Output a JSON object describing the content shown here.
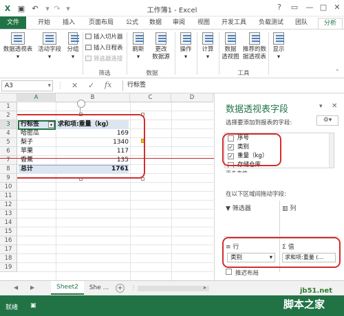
{
  "window": {
    "title": "工作簿1 - Excel",
    "help_label": "?",
    "minimize_label": "—",
    "restore_label": "□",
    "close_label": "✕"
  },
  "tabs": [
    "文件",
    "开始",
    "插入",
    "页面布局",
    "公式",
    "数据",
    "审阅",
    "视图",
    "开发工具",
    "负载测试",
    "团队",
    "分析"
  ],
  "ribbon": {
    "pivot_table": "数据透视表",
    "active_field": "活动字段",
    "group": "分组",
    "insert_slicer": "插入切片器",
    "insert_timeline": "插入日程表",
    "filter_connections": "筛选器连接",
    "filter_group": "筛选",
    "refresh": "刷新",
    "change_source": "更改",
    "change_source_2": "数据源",
    "data_group": "数据",
    "actions": "操作",
    "calculations": "计算",
    "pivot_chart": "数据",
    "pivot_chart_2": "透视图",
    "recommended": "推荐的数",
    "recommended_2": "据透视表",
    "tools_group": "工具",
    "show": "显示"
  },
  "formula_bar": {
    "name_box": "A3",
    "cancel": "✕",
    "enter": "✓",
    "fx": "fx",
    "formula": "行标签"
  },
  "grid": {
    "columns": [
      "A",
      "B",
      "C",
      "D"
    ],
    "rows": [
      "1",
      "2",
      "3",
      "4",
      "5",
      "6",
      "7",
      "8",
      "9",
      "10",
      "11",
      "12",
      "13",
      "14",
      "15",
      "16",
      "17",
      "18",
      "19"
    ],
    "header_label": "行标签",
    "header_value": "求和项:重量（kg）",
    "items": [
      {
        "label": "哈密瓜",
        "value": "169"
      },
      {
        "label": "梨子",
        "value": "1340"
      },
      {
        "label": "苹果",
        "value": "117"
      },
      {
        "label": "香蕉",
        "value": "135"
      }
    ],
    "total_label": "总计",
    "total_value": "1761"
  },
  "panel": {
    "title": "数据透视表字段",
    "choose_fields": "选择要添加到报表的字段:",
    "fields": [
      {
        "name": "序号",
        "checked": false
      },
      {
        "name": "类别",
        "checked": true
      },
      {
        "name": "重量（kg）",
        "checked": true
      },
      {
        "name": "存储仓库",
        "checked": false
      }
    ],
    "more_tables": "更多表格...",
    "drag_fields": "在以下区域间拖动字段:",
    "filters": "筛选器",
    "columns": "列",
    "rows": "行",
    "values": "值",
    "row_field": "类别",
    "value_field": "求和项:重量 (…",
    "defer": "推迟布局"
  },
  "sheets": {
    "active": "Sheet2",
    "other": "She ...",
    "add": "+"
  },
  "status": {
    "ready": "就绪",
    "watermark_url": "jb51.net",
    "watermark_name": "脚本之家"
  }
}
